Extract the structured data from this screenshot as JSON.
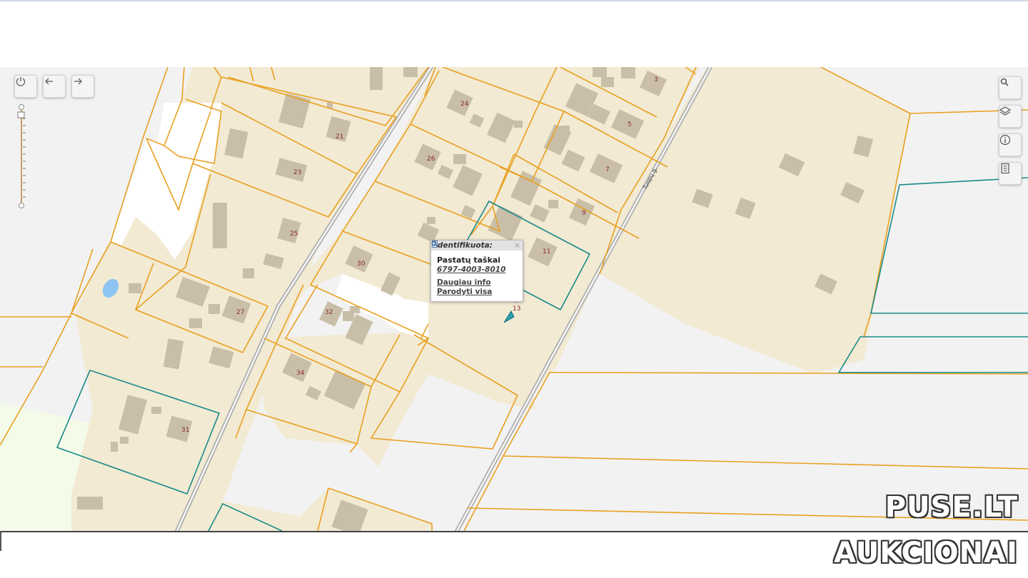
{
  "map": {
    "street_label": "Tuopų g.",
    "house_numbers": [
      "3",
      "5",
      "7",
      "9",
      "11",
      "13",
      "21",
      "23",
      "24",
      "25",
      "26",
      "27",
      "30",
      "31",
      "32",
      "34"
    ]
  },
  "controls": {
    "power_icon": "power-icon",
    "back_icon": "arrow-left-icon",
    "forward_icon": "arrow-right-icon",
    "search_icon": "search-icon",
    "layers_icon": "layers-icon",
    "info_icon": "info-icon",
    "legend_icon": "document-icon"
  },
  "popup": {
    "title": "Identifikuota:",
    "close": "×",
    "layer": "Pastatų taškai",
    "id": "6797-4003-8010",
    "more_info": "Daugiau info",
    "show_all": "Parodyti visa"
  },
  "watermark": {
    "line1": "PUSE.LT",
    "line2": "AUKCIONAI"
  },
  "colors": {
    "parcel_line": "#e8a020",
    "selected_parcel": "#1a8a8a",
    "parcel_fill": "#f2ead3",
    "building": "#c8bda8",
    "road": "#b0b0b0"
  }
}
